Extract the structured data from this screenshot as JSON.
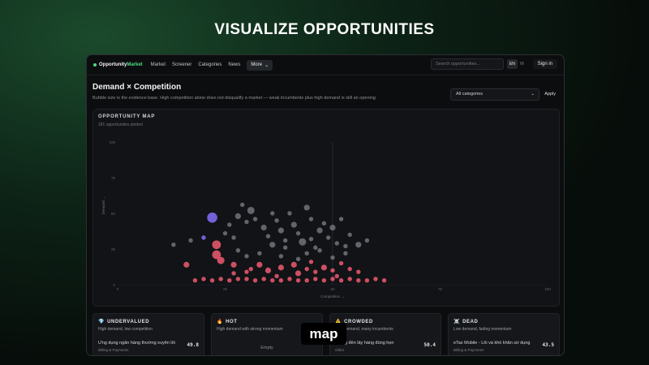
{
  "hero": {
    "title": "VISUALIZE OPPORTUNITIES"
  },
  "nav": {
    "brand_prefix": "Opportunity",
    "brand_suffix": "Market",
    "links": [
      "Market",
      "Screener",
      "Categories",
      "News"
    ],
    "more_label": "More",
    "search_placeholder": "Search opportunities...",
    "lang_en": "EN",
    "lang_vi": "VI",
    "signin_label": "Sign in"
  },
  "page": {
    "title": "Demand × Competition",
    "subtitle": "Bubble size is the evidence base. High competition alone does not disqualify a market — weak incumbents plus high demand is still an opening.",
    "filter_value": "All categories",
    "apply_label": "Apply"
  },
  "map": {
    "title": "OPPORTUNITY MAP",
    "subtitle": "181 opportunities plotted"
  },
  "chart_data": {
    "type": "scatter",
    "xlabel": "Competition →",
    "ylabel": "Demand →",
    "xlim": [
      0,
      100
    ],
    "ylim": [
      0,
      100
    ],
    "xticks": [
      "0",
      "25",
      "50",
      "75",
      "100"
    ],
    "yticks": [
      "0",
      "25",
      "50",
      "75",
      "100"
    ],
    "grid": true,
    "series": [
      {
        "color": "#6b6f76",
        "points": [
          [
            13,
            28,
            3
          ],
          [
            17,
            31,
            3
          ],
          [
            25,
            36,
            3
          ],
          [
            26,
            42,
            3
          ],
          [
            28,
            48,
            4
          ],
          [
            30,
            44,
            3
          ],
          [
            31,
            52,
            5
          ],
          [
            32,
            46,
            3
          ],
          [
            34,
            40,
            4
          ],
          [
            35,
            34,
            3
          ],
          [
            36,
            28,
            4
          ],
          [
            37,
            45,
            3
          ],
          [
            38,
            38,
            4
          ],
          [
            39,
            31,
            3
          ],
          [
            40,
            50,
            3
          ],
          [
            41,
            42,
            4
          ],
          [
            42,
            36,
            3
          ],
          [
            43,
            30,
            5
          ],
          [
            44,
            54,
            4
          ],
          [
            45,
            46,
            3
          ],
          [
            46,
            26,
            3
          ],
          [
            47,
            38,
            4
          ],
          [
            48,
            43,
            3
          ],
          [
            49,
            33,
            3
          ],
          [
            50,
            40,
            4
          ],
          [
            51,
            29,
            3
          ],
          [
            52,
            46,
            3
          ],
          [
            53,
            22,
            3
          ],
          [
            54,
            35,
            3
          ],
          [
            56,
            28,
            4
          ],
          [
            58,
            31,
            3
          ],
          [
            33,
            22,
            3
          ],
          [
            38,
            20,
            3
          ],
          [
            42,
            18,
            3
          ],
          [
            30,
            20,
            3
          ],
          [
            28,
            24,
            3
          ],
          [
            45,
            32,
            3
          ],
          [
            47,
            24,
            3
          ],
          [
            50,
            19,
            3
          ],
          [
            53,
            27,
            3
          ],
          [
            29,
            56,
            3
          ],
          [
            27,
            33,
            3
          ],
          [
            36,
            50,
            3
          ],
          [
            39,
            26,
            3
          ],
          [
            44,
            22,
            3
          ]
        ]
      },
      {
        "color": "#e2566a",
        "points": [
          [
            23,
            28,
            6
          ],
          [
            23,
            21,
            6
          ],
          [
            24,
            17,
            5
          ],
          [
            16,
            14,
            4
          ],
          [
            27,
            14,
            4
          ],
          [
            31,
            11,
            3
          ],
          [
            33,
            14,
            4
          ],
          [
            35,
            10,
            4
          ],
          [
            38,
            12,
            4
          ],
          [
            42,
            8,
            4
          ],
          [
            41,
            14,
            4
          ],
          [
            44,
            11,
            3
          ],
          [
            46,
            9,
            3
          ],
          [
            48,
            12,
            4
          ],
          [
            50,
            10,
            3
          ],
          [
            52,
            15,
            3
          ],
          [
            54,
            11,
            3
          ],
          [
            56,
            9,
            3
          ],
          [
            24,
            4,
            3
          ],
          [
            26,
            3,
            3
          ],
          [
            28,
            4,
            3
          ],
          [
            30,
            4,
            3
          ],
          [
            32,
            3,
            3
          ],
          [
            34,
            4,
            3
          ],
          [
            36,
            3,
            3
          ],
          [
            38,
            3,
            3
          ],
          [
            40,
            4,
            3
          ],
          [
            42,
            3,
            3
          ],
          [
            44,
            3,
            3
          ],
          [
            46,
            4,
            3
          ],
          [
            48,
            3,
            3
          ],
          [
            50,
            4,
            3
          ],
          [
            52,
            3,
            3
          ],
          [
            54,
            4,
            3
          ],
          [
            56,
            3,
            3
          ],
          [
            58,
            3,
            3
          ],
          [
            60,
            4,
            3
          ],
          [
            62,
            3,
            3
          ],
          [
            22,
            3,
            3
          ],
          [
            20,
            4,
            3
          ],
          [
            18,
            3,
            3
          ],
          [
            30,
            9,
            3
          ],
          [
            45,
            16,
            3
          ],
          [
            37,
            6,
            3
          ],
          [
            51,
            6,
            3
          ],
          [
            27,
            8,
            3
          ]
        ]
      },
      {
        "color": "#7c6cf0",
        "points": [
          [
            22,
            47,
            7
          ],
          [
            20,
            33,
            3
          ]
        ]
      }
    ]
  },
  "cards": [
    {
      "icon": "💎",
      "title": "UNDERVALUED",
      "subtitle": "High demand, low competition",
      "item": "Ứng dụng ngân hàng thường xuyên lỗi",
      "category": "Billing & Payments",
      "score": "49.8"
    },
    {
      "icon": "🔥",
      "title": "HOT",
      "subtitle": "High demand with strong momentum",
      "empty": "Empty"
    },
    {
      "icon": "⚠️",
      "title": "CROWDED",
      "subtitle": "High demand, many incumbents",
      "item": "không đến lấy hàng đúng hẹn",
      "category": "Other",
      "score": "50.4"
    },
    {
      "icon": "☠️",
      "title": "DEAD",
      "subtitle": "Low demand, fading momentum",
      "item": "eTax Mobile - Lỗi và khó khăn sử dụng",
      "category": "Billing & Payments",
      "score": "43.5"
    }
  ],
  "overlay": {
    "tag": "map"
  }
}
